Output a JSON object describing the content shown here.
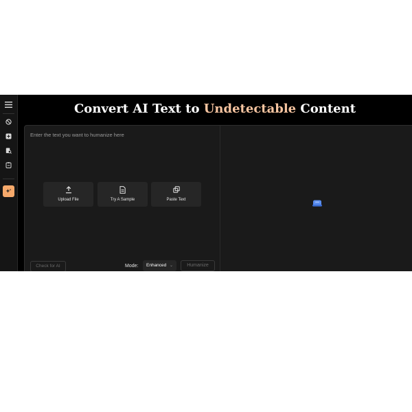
{
  "title": {
    "part1": "Convert AI Text to",
    "accent": "Undetectable",
    "part2": "Content"
  },
  "sidebar": {
    "icons": [
      "menu-icon",
      "ban-icon",
      "plus-square-icon",
      "document-search-icon",
      "clipboard-icon",
      "sparkle-icon"
    ]
  },
  "editor": {
    "placeholder": "Enter the text you want to humanize here",
    "actions": [
      {
        "label": "Upload File",
        "icon": "upload-icon"
      },
      {
        "label": "Try A Sample",
        "icon": "document-icon"
      },
      {
        "label": "Paste Text",
        "icon": "copy-icon"
      }
    ],
    "check_label": "Check for AI",
    "mode_label": "Mode:",
    "mode_value": "Enhanced",
    "humanize_label": "Humanize"
  },
  "colors": {
    "accent": "#f6c4a0",
    "active_tool": "#f6a96b",
    "result_icon": "#5b8ef0"
  }
}
